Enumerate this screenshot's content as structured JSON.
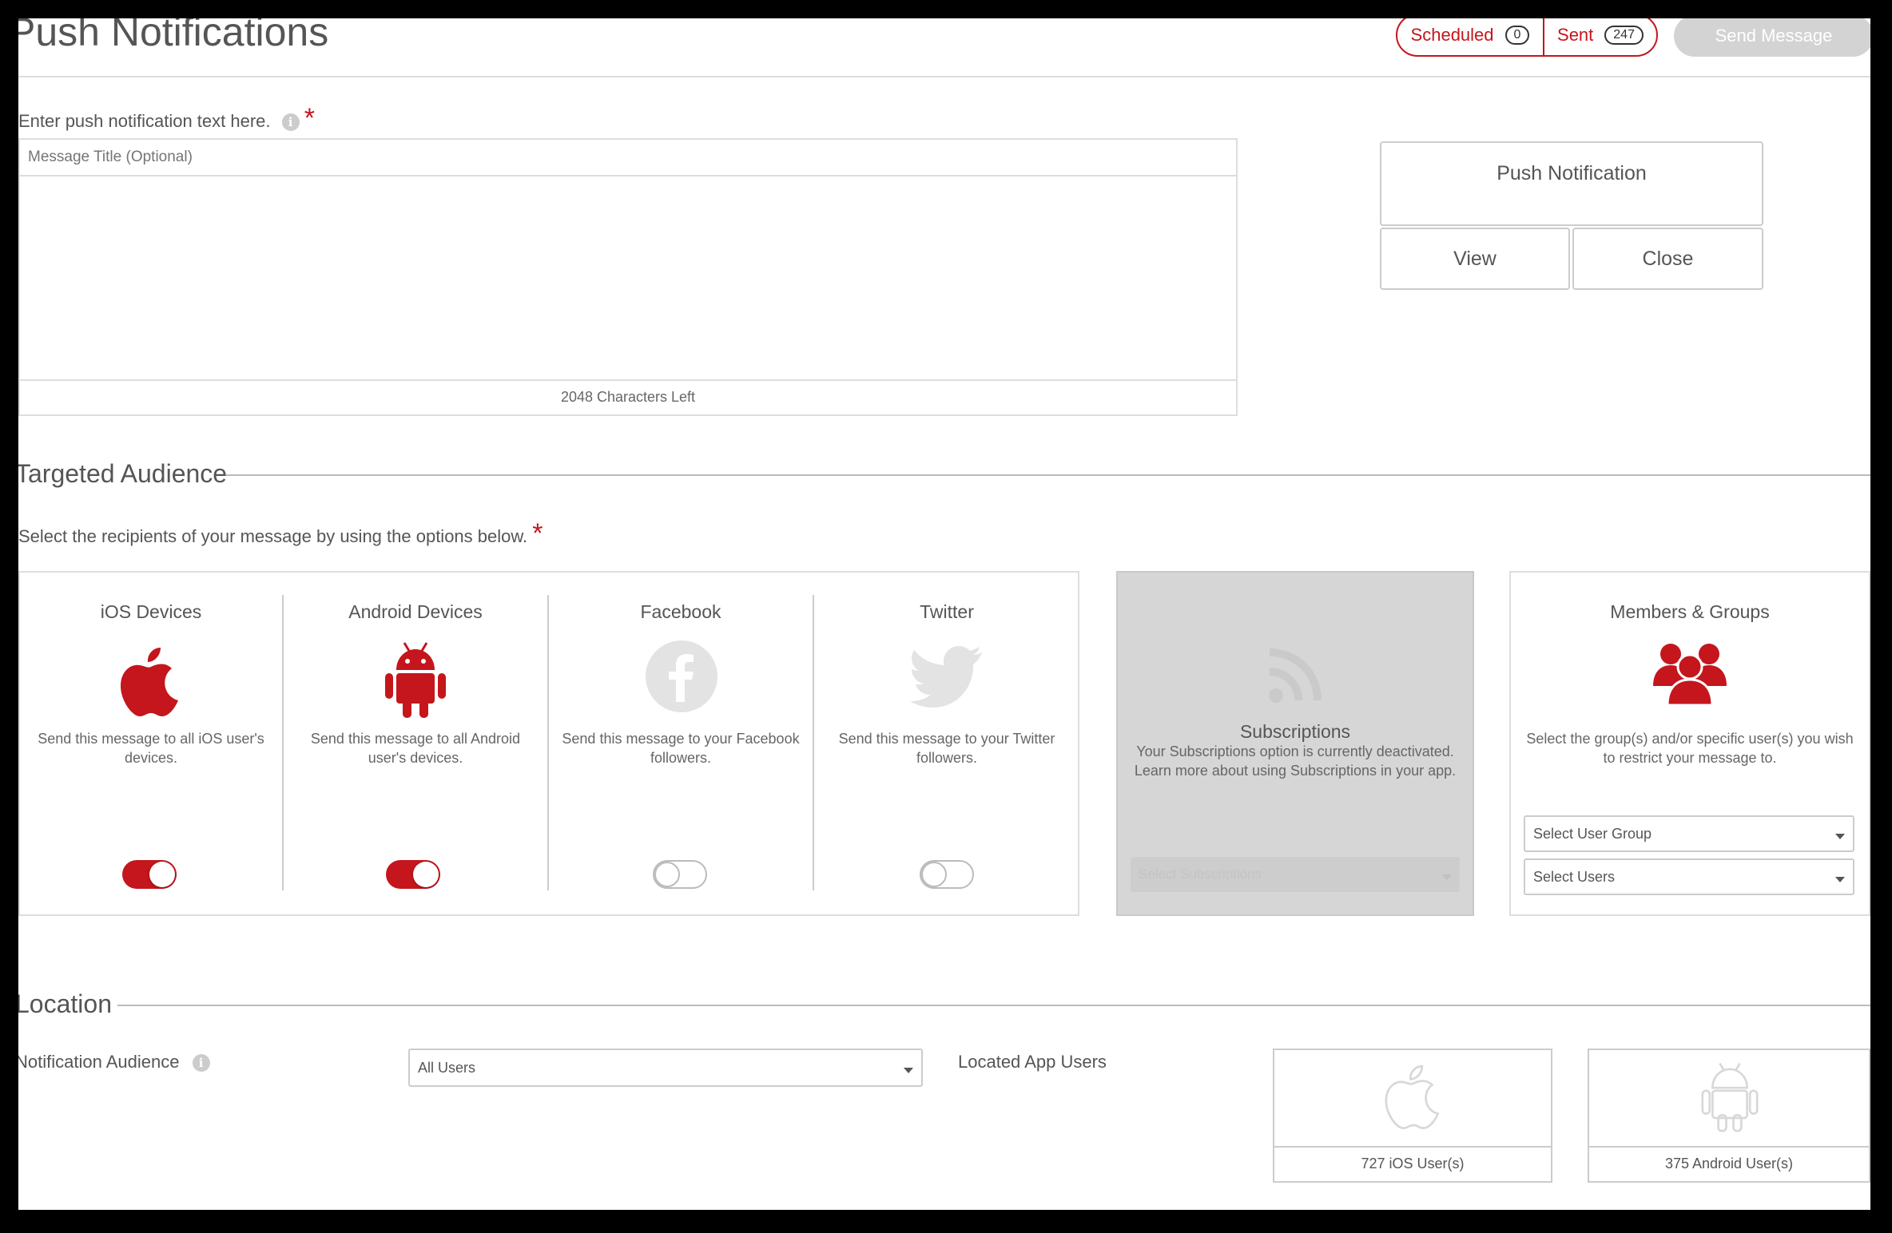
{
  "header": {
    "title": "Push Notifications",
    "scheduled_label": "Scheduled",
    "scheduled_count": "0",
    "sent_label": "Sent",
    "sent_count": "247",
    "send_button": "Send Message"
  },
  "message": {
    "instruction": "Enter push notification text here.",
    "title_placeholder": "Message Title (Optional)",
    "body_value": "",
    "chars_left": "2048 Characters Left"
  },
  "preview": {
    "title": "Push Notification",
    "view_label": "View",
    "close_label": "Close"
  },
  "audience": {
    "section_title": "Targeted Audience",
    "instruction": "Select the recipients of your message by using the options below.",
    "options": [
      {
        "title": "iOS Devices",
        "desc": "Send this message to all iOS user's devices.",
        "icon": "apple-icon",
        "enabled": true
      },
      {
        "title": "Android Devices",
        "desc": "Send this message to all Android user's devices.",
        "icon": "android-icon",
        "enabled": true
      },
      {
        "title": "Facebook",
        "desc": "Send this message to your Facebook followers.",
        "icon": "facebook-icon",
        "enabled": false
      },
      {
        "title": "Twitter",
        "desc": "Send this message to your Twitter followers.",
        "icon": "twitter-icon",
        "enabled": false
      }
    ],
    "subscriptions": {
      "title": "Subscriptions",
      "desc": "Your Subscriptions option is currently deactivated. Learn more about using Subscriptions in your app.",
      "select_placeholder": "Select Subscriptions"
    },
    "members": {
      "title": "Members & Groups",
      "desc": "Select the group(s) and/or specific user(s) you wish to restrict your message to.",
      "group_select": "Select User Group",
      "users_select": "Select Users"
    }
  },
  "location": {
    "section_title": "Location",
    "audience_label": "Notification Audience",
    "audience_value": "All Users",
    "located_label": "Located App Users",
    "ios_users": "727 iOS User(s)",
    "android_users": "375 Android User(s)"
  },
  "colors": {
    "accent": "#c4161c",
    "border": "#dddddd",
    "disabled_panel": "#d6d6d6",
    "text": "#555555"
  }
}
